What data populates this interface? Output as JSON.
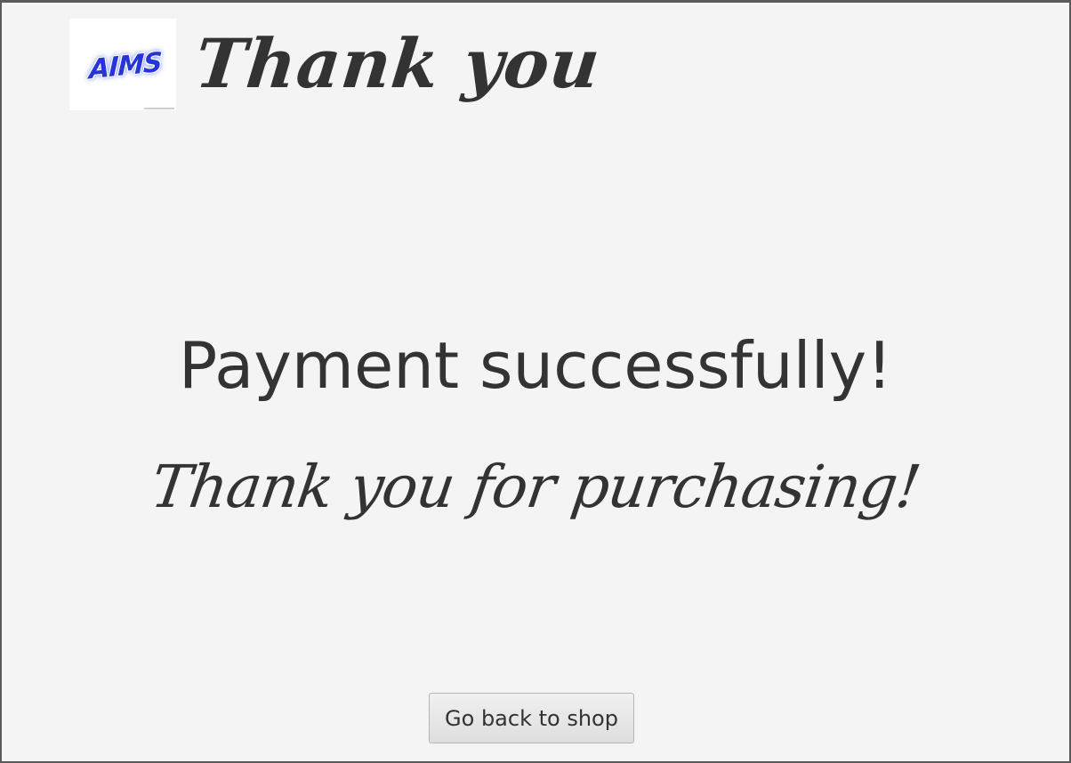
{
  "header": {
    "logo_text": "AIMS",
    "title": "Thank you"
  },
  "main": {
    "success_message": "Payment successfully!",
    "thanks_message": "Thank you for purchasing!"
  },
  "actions": {
    "back_label": "Go back to shop"
  },
  "colors": {
    "background": "#f4f4f4",
    "text": "#333333",
    "logo_accent": "#2735d6"
  }
}
